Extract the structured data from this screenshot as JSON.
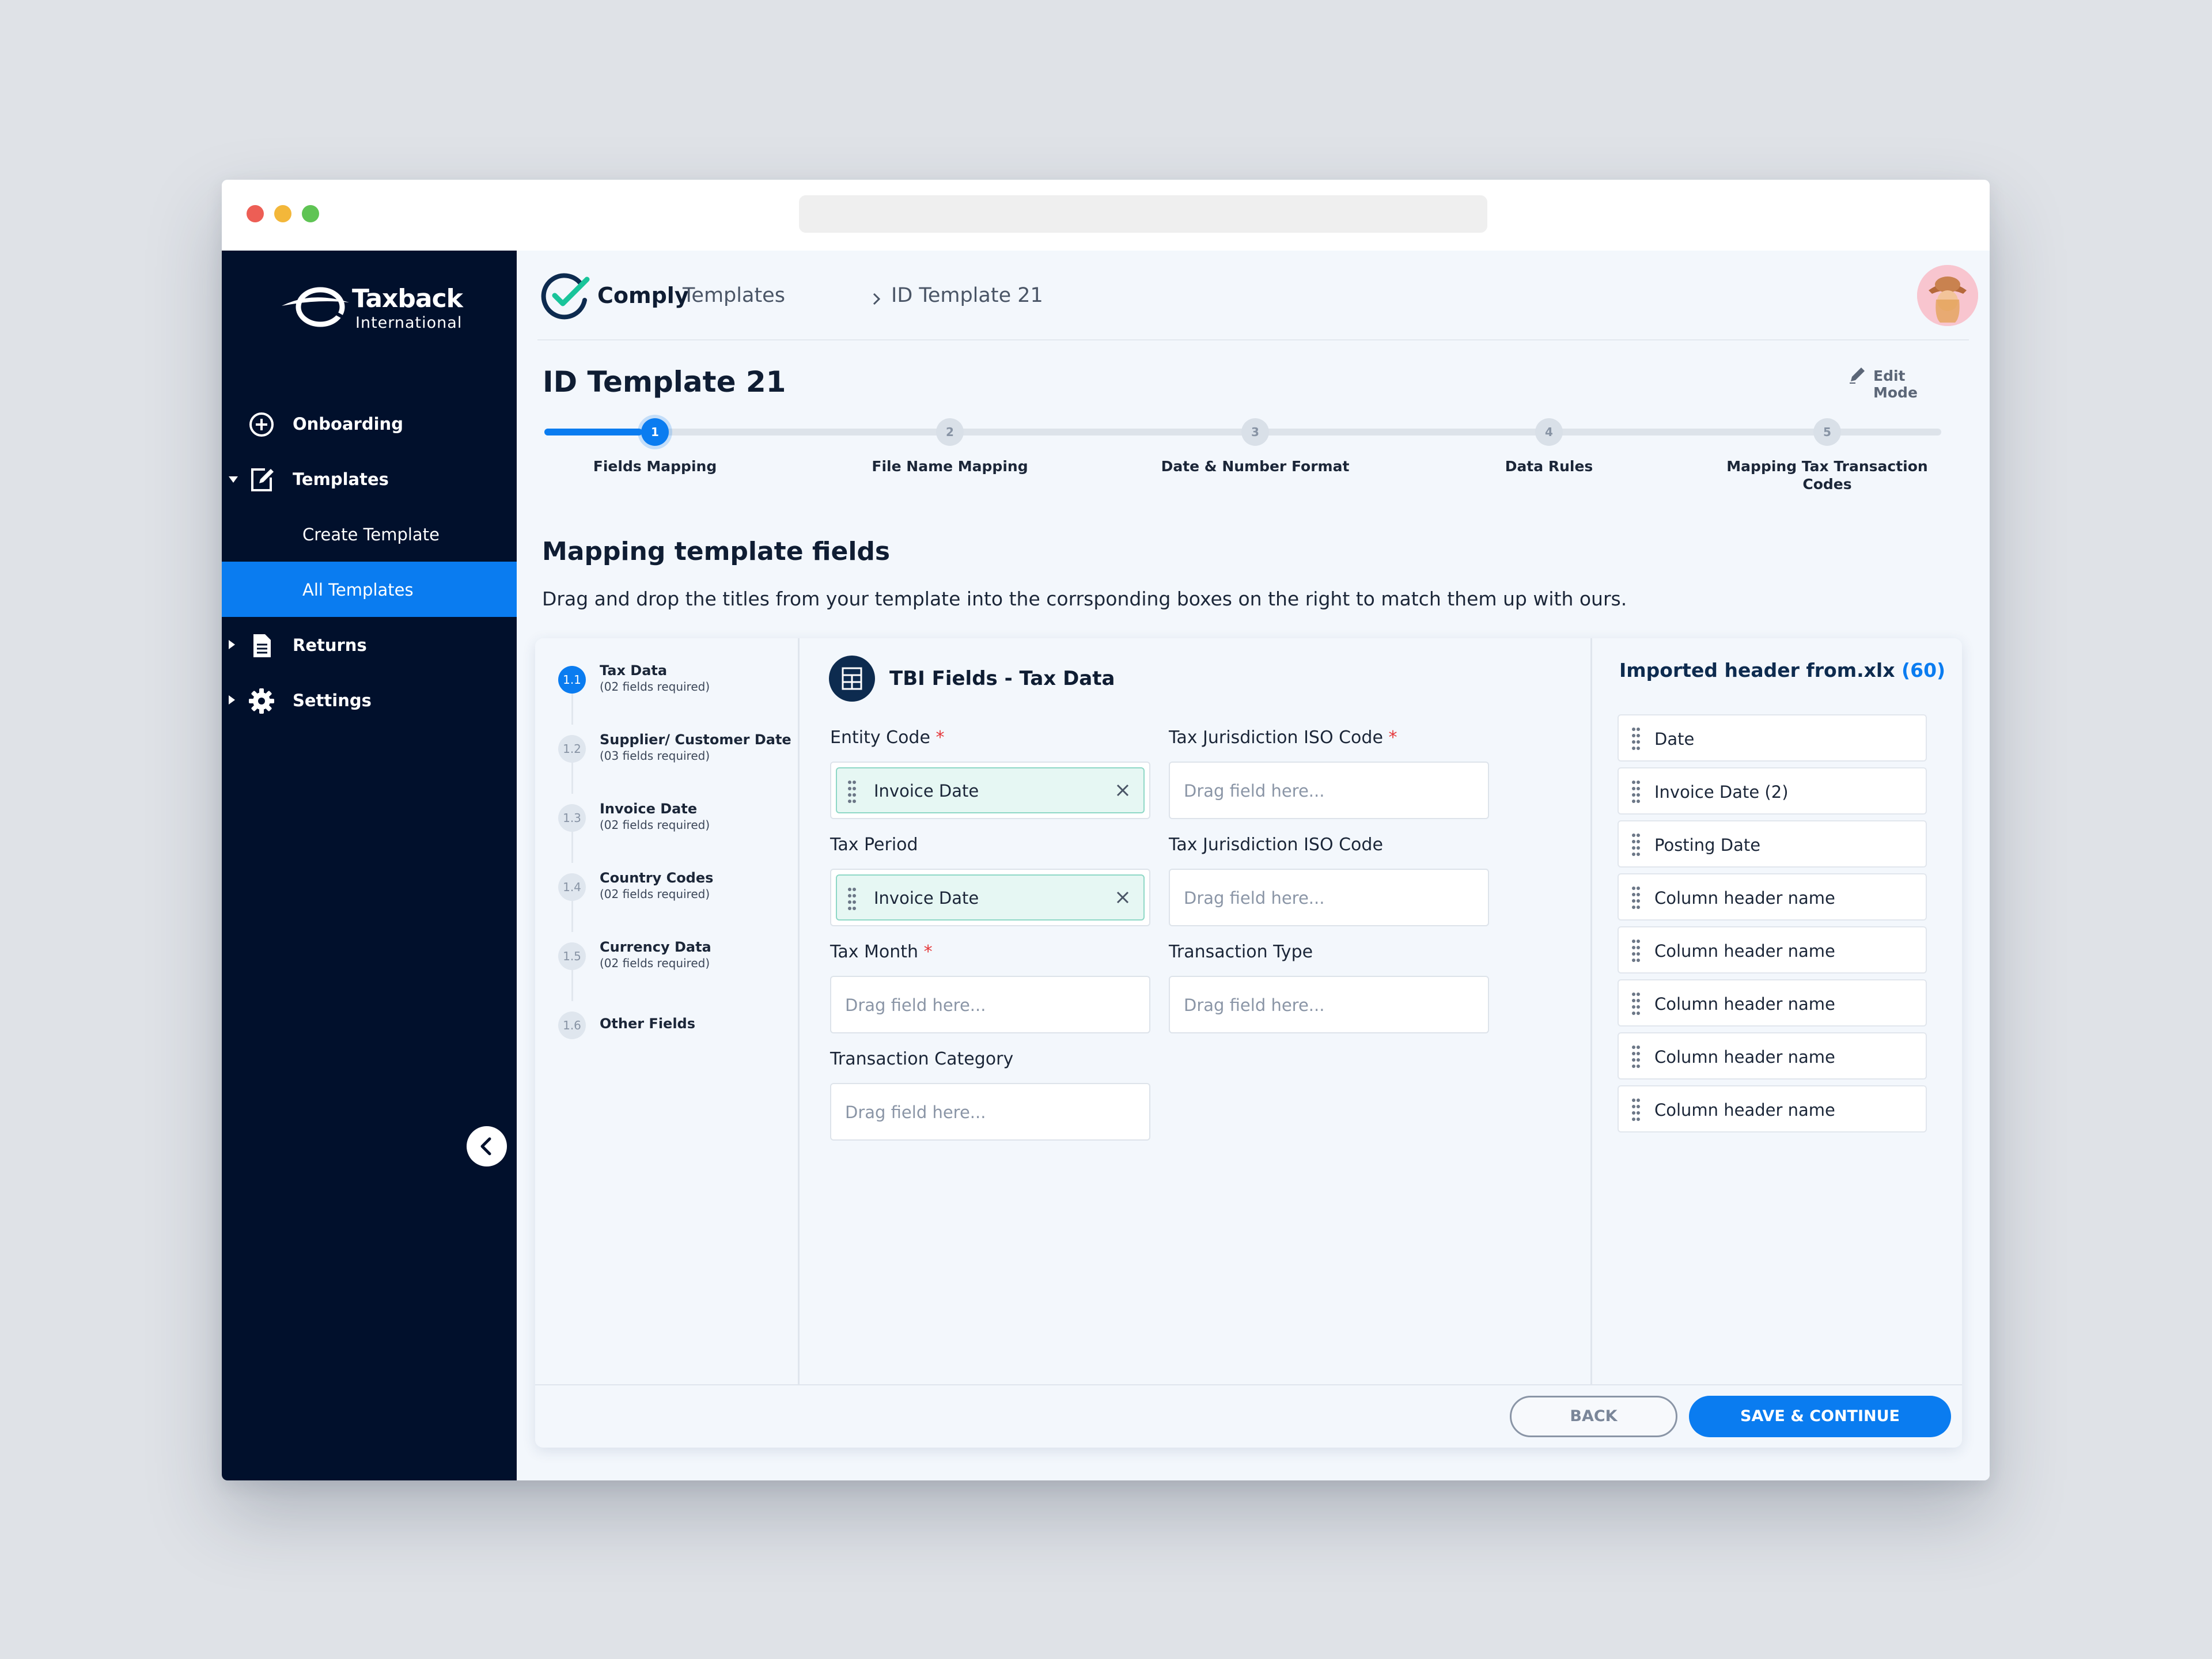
{
  "app": {
    "brand": "Taxback",
    "brand_sub": "International",
    "product": "Comply"
  },
  "sidebar": {
    "items": [
      {
        "label": "Onboarding",
        "icon": "plus-circle-icon"
      },
      {
        "label": "Templates",
        "icon": "edit-icon",
        "expanded": true,
        "children": [
          {
            "label": "Create Template"
          },
          {
            "label": "All Templates",
            "active": true
          }
        ]
      },
      {
        "label": "Returns",
        "icon": "document-icon"
      },
      {
        "label": "Settings",
        "icon": "gear-icon"
      }
    ]
  },
  "breadcrumb": [
    "Templates",
    "ID Template 21"
  ],
  "page": {
    "title": "ID Template 21",
    "edit_mode": "Edit Mode"
  },
  "stepper": {
    "progress": 0.07,
    "steps": [
      {
        "num": "1",
        "label": "Fields Mapping",
        "active": true
      },
      {
        "num": "2",
        "label": "File Name Mapping"
      },
      {
        "num": "3",
        "label": "Date & Number Format"
      },
      {
        "num": "4",
        "label": "Data Rules"
      },
      {
        "num": "5",
        "label": "Mapping Tax Transaction Codes"
      }
    ]
  },
  "section": {
    "title": "Mapping template fields",
    "description": "Drag and drop the titles from your template into the corrsponding boxes on the right to match them up with ours."
  },
  "sections_nav": [
    {
      "num": "1.1",
      "title": "Tax Data",
      "sub": "(02 fields required)",
      "active": true
    },
    {
      "num": "1.2",
      "title": "Supplier/ Customer Date",
      "sub": "(03 fields required)"
    },
    {
      "num": "1.3",
      "title": "Invoice Date",
      "sub": "(02 fields required)"
    },
    {
      "num": "1.4",
      "title": "Country Codes",
      "sub": "(02 fields required)"
    },
    {
      "num": "1.5",
      "title": "Currency Data",
      "sub": "(02 fields required)"
    },
    {
      "num": "1.6",
      "title": "Other Fields",
      "sub": ""
    }
  ],
  "tbi": {
    "title": "TBI Fields - Tax Data",
    "required_mark": "*",
    "placeholder": "Drag field here...",
    "fields": [
      {
        "label": "Entity Code",
        "required": true,
        "value": "Invoice Date"
      },
      {
        "label": "Tax Jurisdiction ISO Code",
        "required": true,
        "value": ""
      },
      {
        "label": "Tax Period",
        "required": false,
        "value": "Invoice Date"
      },
      {
        "label": "Tax Jurisdiction ISO Code",
        "required": false,
        "value": ""
      },
      {
        "label": "Tax Month",
        "required": true,
        "value": ""
      },
      {
        "label": "Transaction Type",
        "required": false,
        "value": ""
      },
      {
        "label": "Transaction Category",
        "required": false,
        "value": ""
      }
    ]
  },
  "imported": {
    "title": "Imported header from.xlx",
    "count": "(60)",
    "items": [
      "Date",
      "Invoice Date (2)",
      "Posting Date",
      "Column header name",
      "Column header name",
      "Column header name",
      "Column header name",
      "Column header name"
    ]
  },
  "footer": {
    "back": "BACK",
    "save": "SAVE & CONTINUE"
  },
  "colors": {
    "sidebar_bg": "#01102c",
    "accent": "#0a7cf0",
    "chip_bg": "#e6f7f3",
    "required": "#e5383b"
  }
}
